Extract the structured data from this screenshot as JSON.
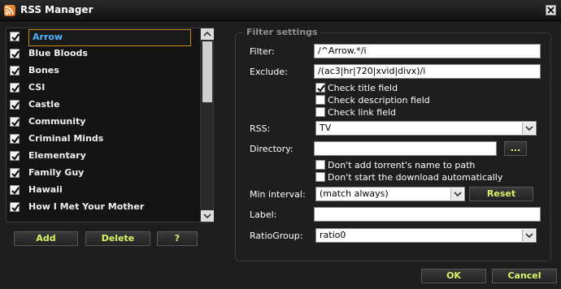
{
  "window": {
    "title": "RSS Manager"
  },
  "list": {
    "items": [
      {
        "label": "Arrow",
        "checked": true,
        "selected": true
      },
      {
        "label": "Blue Bloods",
        "checked": true
      },
      {
        "label": "Bones",
        "checked": true
      },
      {
        "label": "CSI",
        "checked": true
      },
      {
        "label": "Castle",
        "checked": true
      },
      {
        "label": "Community",
        "checked": true
      },
      {
        "label": "Criminal Minds",
        "checked": true
      },
      {
        "label": "Elementary",
        "checked": true
      },
      {
        "label": "Family Guy",
        "checked": true
      },
      {
        "label": "Hawaii",
        "checked": true
      },
      {
        "label": "How I Met Your Mother",
        "checked": true
      }
    ]
  },
  "list_buttons": {
    "add": "Add",
    "delete": "Delete",
    "help": "?"
  },
  "filter": {
    "legend": "Filter settings",
    "filter_label": "Filter:",
    "filter_value": "/^Arrow.*/i",
    "exclude_label": "Exclude:",
    "exclude_value": "/(ac3|hr|720|xvid|divx)/i",
    "check_title": "Check title field",
    "check_description": "Check description field",
    "check_link": "Check link field",
    "rss_label": "RSS:",
    "rss_value": "TV",
    "directory_label": "Directory:",
    "directory_value": "",
    "browse_label": "...",
    "no_torrent_name": "Don't add torrent's name to path",
    "no_autostart": "Don't start the download automatically",
    "min_interval_label": "Min interval:",
    "min_interval_value": "(match always)",
    "reset_label": "Reset",
    "label_label": "Label:",
    "label_value": "",
    "ratiogroup_label": "RatioGroup:",
    "ratiogroup_value": "ratio0"
  },
  "checkbox_states": {
    "check_title": true,
    "check_description": false,
    "check_link": false,
    "no_torrent_name": false,
    "no_autostart": false
  },
  "footer": {
    "ok": "OK",
    "cancel": "Cancel"
  },
  "colors": {
    "button_text": "#d8f56a",
    "selected_text": "#4fb4ff",
    "selected_border": "#c78a1c"
  }
}
